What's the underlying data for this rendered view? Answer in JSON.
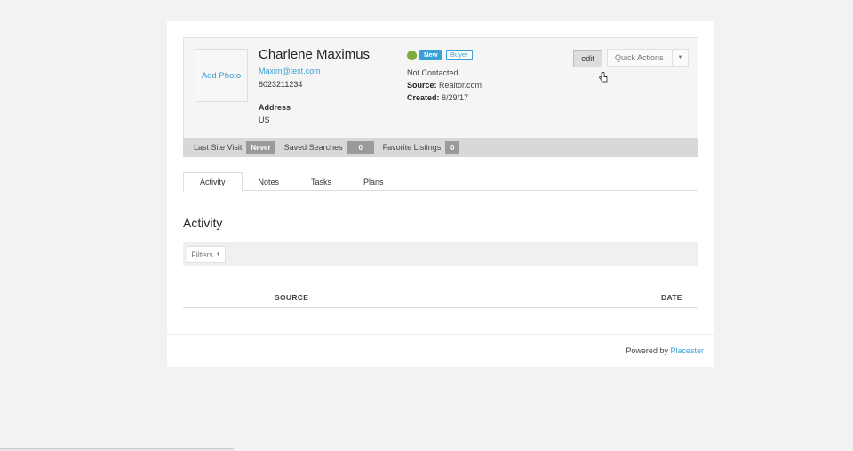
{
  "profile": {
    "add_photo": "Add Photo",
    "name": "Charlene Maximus",
    "email": "Maxim@test.com",
    "phone": "8023211234",
    "address_label": "Address",
    "address_value": "US",
    "badge_new": "New",
    "badge_buyer": "Buyer",
    "contact_status": "Not Contacted",
    "source_label": "Source:",
    "source_value": "Realtor.com",
    "created_label": "Created:",
    "created_value": "8/29/17",
    "status_color": "#7cad3c"
  },
  "actions": {
    "edit_label": "edit",
    "quick_actions_label": "Quick Actions"
  },
  "stats": {
    "last_visit_label": "Last Site Visit",
    "last_visit_value": "Never",
    "saved_searches_label": "Saved Searches",
    "saved_searches_value": "0",
    "favorite_listings_label": "Favorite Listings",
    "favorite_listings_value": "0"
  },
  "tabs": [
    {
      "label": "Activity"
    },
    {
      "label": "Notes"
    },
    {
      "label": "Tasks"
    },
    {
      "label": "Plans"
    }
  ],
  "activity": {
    "title": "Activity",
    "filters_label": "Filters",
    "col_source": "SOURCE",
    "col_date": "DATE"
  },
  "footer": {
    "powered_by": "Powered by",
    "brand": "Placester"
  },
  "colors": {
    "accent": "#3aa0d6"
  }
}
